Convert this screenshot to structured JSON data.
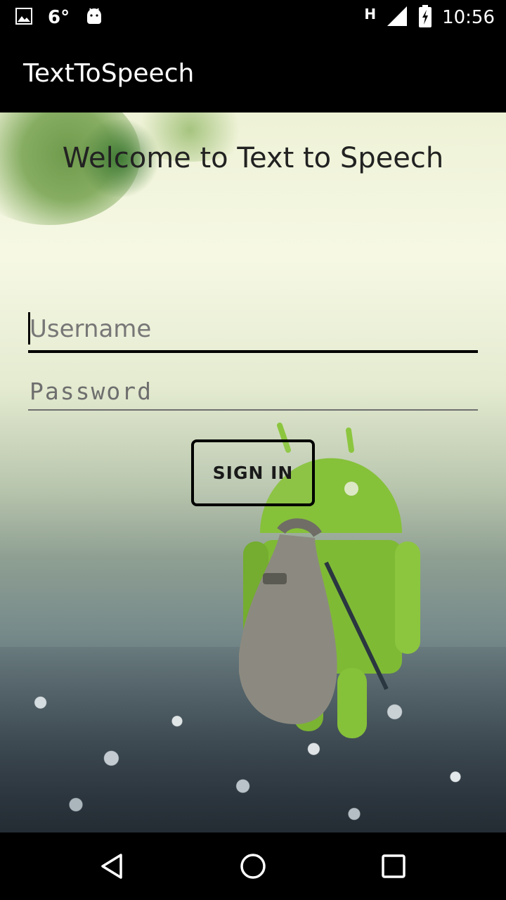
{
  "status_bar": {
    "temperature": "6°",
    "network_type": "H",
    "time": "10:56",
    "icons": [
      "image-notification-icon",
      "android-notification-icon",
      "signal-icon",
      "battery-charging-icon"
    ]
  },
  "app_bar": {
    "title": "TextToSpeech"
  },
  "main": {
    "welcome_text": "Welcome to Text to Speech",
    "username": {
      "placeholder": "Username",
      "value": ""
    },
    "password": {
      "placeholder": "Password",
      "value": ""
    },
    "sign_in_label": "SIGN IN"
  },
  "nav_bar": {
    "icons": [
      "back-icon",
      "home-icon",
      "recents-icon"
    ]
  },
  "colors": {
    "app_bar": "#000000",
    "robot_green": "#8cc63f",
    "text": "#222222"
  }
}
